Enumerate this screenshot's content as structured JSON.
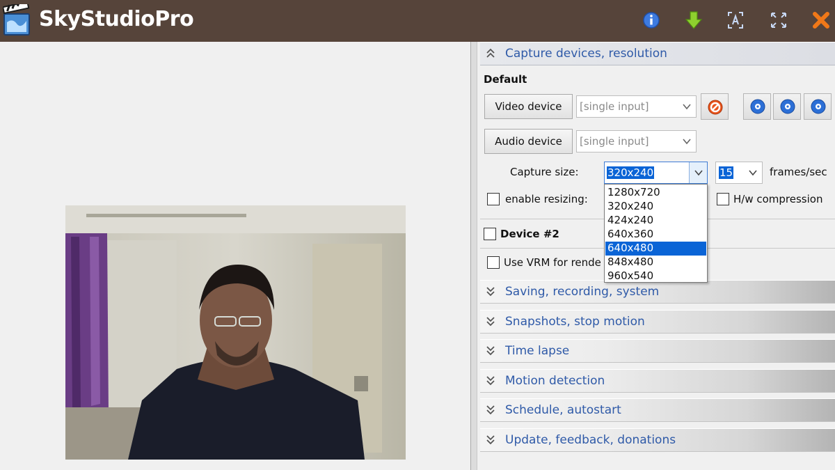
{
  "app": {
    "title": "SkyStudioPro"
  },
  "titlebar_icons": [
    "info-icon",
    "download-icon",
    "fit-screen-icon",
    "fullscreen-icon",
    "close-icon"
  ],
  "colors": {
    "titlebar": "#56443a",
    "accent_link": "#2f5aa8",
    "selection": "#0a64d6",
    "close": "#f07818"
  },
  "capture": {
    "section_title": "Capture devices, resolution",
    "default_label": "Default",
    "video_device_button": "Video device",
    "video_input_value": "[single input]",
    "audio_device_button": "Audio device",
    "audio_input_value": "[single input]",
    "capture_size_label": "Capture size:",
    "capture_size_value": "320x240",
    "fps_value": "15",
    "fps_label": "frames/sec",
    "enable_resizing_label": "enable resizing:",
    "hw_compression_label": "H/w compression",
    "device2_label": "Device #2",
    "vrm_label": "Use VRM for rende",
    "size_options": [
      "1280x720",
      "320x240",
      "424x240",
      "640x360",
      "640x480",
      "848x480",
      "960x540"
    ],
    "selected_option": "640x480"
  },
  "sections": [
    "Saving, recording, system",
    "Snapshots, stop motion",
    "Time lapse",
    "Motion detection",
    "Schedule, autostart",
    "Update, feedback, donations"
  ]
}
